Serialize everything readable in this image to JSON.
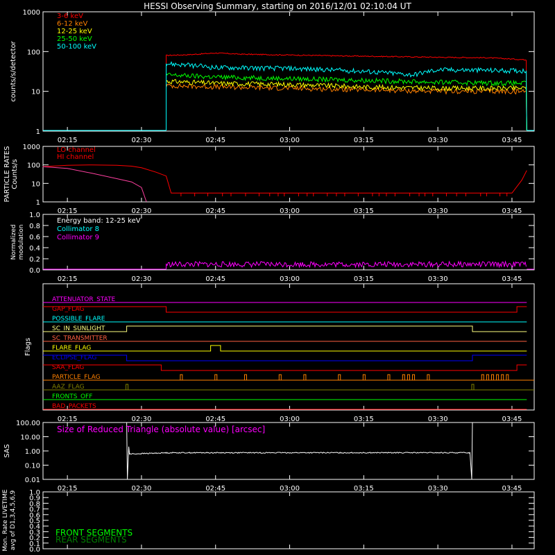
{
  "title": "HESSI Observing Summary, starting on 2016/12/01 02:10:04 UT",
  "time_ticks": [
    "02:15",
    "02:30",
    "02:45",
    "03:00",
    "03:15",
    "03:30",
    "03:45"
  ],
  "chart_data": [
    {
      "type": "line",
      "ylabel": "counts/s/detector",
      "yscale": "log",
      "ylim": [
        1,
        1000
      ],
      "yticks": [
        "1",
        "10",
        "100",
        "1000"
      ],
      "series": [
        {
          "name": "3-6 keV",
          "color": "#ff0000",
          "start": "02:35",
          "end": "03:48",
          "x": [
            "02:35",
            "02:40",
            "02:45",
            "02:50",
            "03:00",
            "03:10",
            "03:20",
            "03:30",
            "03:40",
            "03:48"
          ],
          "values": [
            80,
            84,
            92,
            86,
            82,
            78,
            75,
            72,
            70,
            62
          ]
        },
        {
          "name": "6-12 keV",
          "color": "#ff8000",
          "start": "02:35",
          "end": "03:48",
          "x": [
            "02:35",
            "02:45",
            "03:00",
            "03:15",
            "03:30",
            "03:48"
          ],
          "values": [
            14,
            13,
            12,
            11,
            10,
            10
          ]
        },
        {
          "name": "12-25 keV",
          "color": "#ffff00",
          "start": "02:35",
          "end": "03:48",
          "x": [
            "02:35",
            "02:45",
            "03:00",
            "03:15",
            "03:30",
            "03:48"
          ],
          "values": [
            18,
            16,
            15,
            13,
            12,
            12
          ]
        },
        {
          "name": "25-50 keV",
          "color": "#00ff00",
          "start": "02:35",
          "end": "03:48",
          "x": [
            "02:35",
            "02:45",
            "03:00",
            "03:15",
            "03:30",
            "03:48"
          ],
          "values": [
            26,
            23,
            21,
            19,
            17,
            16
          ]
        },
        {
          "name": "50-100 keV",
          "color": "#00ffff",
          "start": "02:35",
          "end": "03:48",
          "x": [
            "02:35",
            "02:45",
            "03:00",
            "03:15",
            "03:25",
            "03:30",
            "03:48"
          ],
          "values": [
            50,
            40,
            38,
            32,
            26,
            35,
            33
          ]
        }
      ]
    },
    {
      "type": "line",
      "ylabel": "PARTICLE RATES Counts/s",
      "yscale": "log",
      "ylim": [
        1,
        1000
      ],
      "yticks": [
        "1",
        "10",
        "100",
        "1000"
      ],
      "series": [
        {
          "name": "LO channel",
          "color": "#ff0000",
          "x": [
            "02:10",
            "02:15",
            "02:20",
            "02:25",
            "02:28",
            "02:30",
            "02:33",
            "02:35",
            "02:36",
            "03:45",
            "03:47",
            "03:48"
          ],
          "values": [
            80,
            95,
            100,
            95,
            85,
            70,
            40,
            25,
            3,
            3,
            15,
            50
          ]
        },
        {
          "name": "HI channel",
          "color": "#ff0000",
          "x": [
            "02:10",
            "02:15",
            "02:20",
            "02:25",
            "02:28",
            "02:30",
            "02:31"
          ],
          "values": [
            80,
            65,
            35,
            18,
            12,
            6,
            1
          ]
        }
      ]
    },
    {
      "type": "line",
      "ylabel": "Normalized modulation",
      "ylim": [
        0,
        1.0
      ],
      "yticks": [
        "0.0",
        "0.2",
        "0.4",
        "0.6",
        "0.8",
        "1.0"
      ],
      "annotations": [
        "Energy band: 12-25 keV"
      ],
      "series": [
        {
          "name": "Collimator 8",
          "color": "#00ffff",
          "x": [],
          "values": []
        },
        {
          "name": "Collimator 9",
          "color": "#ff00ff",
          "start": "02:35",
          "end": "03:48",
          "level": 0.1
        }
      ]
    },
    {
      "type": "line",
      "ylabel": "Flags",
      "series": [
        {
          "name": "ATTENUATOR_STATE",
          "color": "#ff00ff",
          "segments": [
            [
              "02:10",
              "03:48",
              0
            ]
          ]
        },
        {
          "name": "GAP_FLAG",
          "color": "#ff0000",
          "segments": [
            [
              "02:10",
              "02:35",
              1
            ],
            [
              "02:35",
              "03:46",
              0
            ],
            [
              "03:46",
              "03:48",
              1
            ]
          ]
        },
        {
          "name": "POSSIBLE_FLARE",
          "color": "#00ffff",
          "segments": [
            [
              "02:10",
              "03:48",
              0
            ]
          ]
        },
        {
          "name": "SC_IN_SUNLIGHT",
          "color": "#ffff80",
          "segments": [
            [
              "02:10",
              "02:27",
              0
            ],
            [
              "02:27",
              "03:37",
              1
            ],
            [
              "03:37",
              "03:48",
              0
            ]
          ]
        },
        {
          "name": "SC_TRANSMITTER",
          "color": "#ff6040",
          "segments": [
            [
              "02:10",
              "03:48",
              0
            ]
          ]
        },
        {
          "name": "FLARE_FLAG",
          "color": "#ffff00",
          "segments": [
            [
              "02:10",
              "02:44",
              0
            ],
            [
              "02:44",
              "02:46",
              1
            ],
            [
              "02:46",
              "03:48",
              0
            ]
          ]
        },
        {
          "name": "ECLIPSE_FLAG",
          "color": "#0000ff",
          "segments": [
            [
              "02:10",
              "02:27",
              1
            ],
            [
              "02:27",
              "03:37",
              0
            ],
            [
              "03:37",
              "03:48",
              1
            ]
          ]
        },
        {
          "name": "SAA_FLAG",
          "color": "#ff0000",
          "segments": [
            [
              "02:10",
              "02:34",
              1
            ],
            [
              "02:34",
              "03:46",
              0
            ],
            [
              "03:46",
              "03:48",
              1
            ]
          ]
        },
        {
          "name": "PARTICLE_FLAG",
          "color": "#ff8000",
          "spikes": [
            "02:38",
            "02:45",
            "02:51",
            "02:58",
            "03:03",
            "03:10",
            "03:15",
            "03:20",
            "03:23",
            "03:24",
            "03:25",
            "03:28",
            "03:39",
            "03:40",
            "03:41",
            "03:42",
            "03:43",
            "03:44"
          ]
        },
        {
          "name": "AAZ_FLAG",
          "color": "#808000",
          "spikes": [
            "02:27",
            "03:37"
          ]
        },
        {
          "name": "FRONTS_OFF",
          "color": "#00ff00",
          "segments": [
            [
              "02:10",
              "03:48",
              0
            ]
          ]
        },
        {
          "name": "BAD_PACKETS",
          "color": "#ff0000",
          "segments": [
            [
              "02:10",
              "03:48",
              0
            ]
          ]
        }
      ]
    },
    {
      "type": "line",
      "ylabel": "SAS",
      "yscale": "log",
      "ylim": [
        0.01,
        100
      ],
      "yticks": [
        "0.01",
        "0.10",
        "1.00",
        "10.00",
        "100.00"
      ],
      "annotations": [
        "Size of Reduced Triangle (absolute value) [arcsec]"
      ],
      "series": [
        {
          "name": "",
          "color": "#ffffff",
          "x": [
            "02:27",
            "02:28",
            "02:30",
            "02:40",
            "03:00",
            "03:20",
            "03:36",
            "03:37"
          ],
          "values": [
            100,
            0.7,
            0.6,
            0.75,
            0.72,
            0.7,
            0.65,
            100
          ]
        }
      ]
    },
    {
      "type": "line",
      "ylabel": "Mon. Rate LIVETIME avg of D1,3,4,5,6,9",
      "ylim": [
        0,
        1.0
      ],
      "yticks": [
        "0.0",
        "0.1",
        "0.2",
        "0.3",
        "0.4",
        "0.5",
        "0.6",
        "0.7",
        "0.8",
        "0.9",
        "1.0"
      ],
      "series": [
        {
          "name": "FRONT SEGMENTS",
          "color": "#00ff00",
          "x": [],
          "values": []
        },
        {
          "name": "REAR SEGMENTS",
          "color": "#008000",
          "x": [],
          "values": []
        }
      ]
    }
  ]
}
